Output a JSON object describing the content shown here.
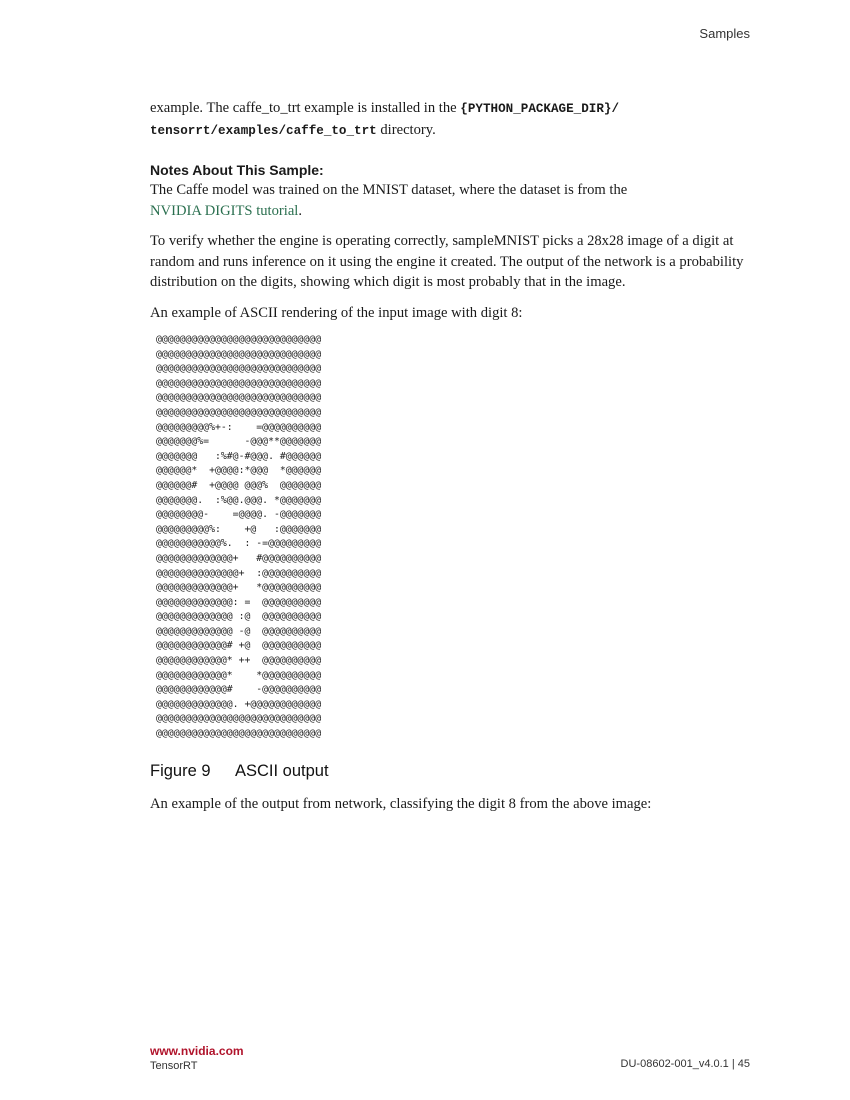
{
  "header": {
    "section": "Samples"
  },
  "body": {
    "intro_pre": "example. The caffe_to_trt example is installed in the ",
    "intro_code1": "{PYTHON_PACKAGE_DIR}/",
    "intro_code2": "tensorrt/examples/caffe_to_trt",
    "intro_post": " directory.",
    "notes_heading": "Notes About This Sample:",
    "notes_text": "The Caffe model was trained on the MNIST dataset, where the dataset is from the",
    "notes_link": "NVIDIA DIGITS tutorial",
    "notes_link_end": ".",
    "verify_paragraph": "To verify whether the engine is operating correctly, sampleMNIST picks a 28x28 image of a digit at random and runs inference on it using the engine it created. The output of the network is a probability distribution on the digits, showing which digit is most probably that in the image.",
    "ascii_intro": "An example of ASCII rendering of the input image with digit 8:",
    "ascii_art": "@@@@@@@@@@@@@@@@@@@@@@@@@@@@\n@@@@@@@@@@@@@@@@@@@@@@@@@@@@\n@@@@@@@@@@@@@@@@@@@@@@@@@@@@\n@@@@@@@@@@@@@@@@@@@@@@@@@@@@\n@@@@@@@@@@@@@@@@@@@@@@@@@@@@\n@@@@@@@@@@@@@@@@@@@@@@@@@@@@\n@@@@@@@@@%+-:    =@@@@@@@@@@\n@@@@@@@%=      -@@@**@@@@@@@\n@@@@@@@   :%#@-#@@@. #@@@@@@\n@@@@@@*  +@@@@:*@@@  *@@@@@@\n@@@@@@#  +@@@@ @@@%  @@@@@@@\n@@@@@@@.  :%@@.@@@. *@@@@@@@\n@@@@@@@@-    =@@@@. -@@@@@@@\n@@@@@@@@@%:    +@   :@@@@@@@\n@@@@@@@@@@@%.  : -=@@@@@@@@@\n@@@@@@@@@@@@@+   #@@@@@@@@@@\n@@@@@@@@@@@@@@+  :@@@@@@@@@@\n@@@@@@@@@@@@@+   *@@@@@@@@@@\n@@@@@@@@@@@@@: =  @@@@@@@@@@\n@@@@@@@@@@@@@ :@  @@@@@@@@@@\n@@@@@@@@@@@@@ -@  @@@@@@@@@@\n@@@@@@@@@@@@# +@  @@@@@@@@@@\n@@@@@@@@@@@@* ++  @@@@@@@@@@\n@@@@@@@@@@@@*    *@@@@@@@@@@\n@@@@@@@@@@@@#    -@@@@@@@@@@\n@@@@@@@@@@@@@. +@@@@@@@@@@@@\n@@@@@@@@@@@@@@@@@@@@@@@@@@@@\n@@@@@@@@@@@@@@@@@@@@@@@@@@@@",
    "figure_number": "Figure 9",
    "figure_title": "ASCII output",
    "output_paragraph": "An example of the output from network, classifying the digit 8 from the above image:"
  },
  "footer": {
    "url": "www.nvidia.com",
    "product": "TensorRT",
    "doc_id": "DU-08602-001_v4.0.1 | 45"
  }
}
